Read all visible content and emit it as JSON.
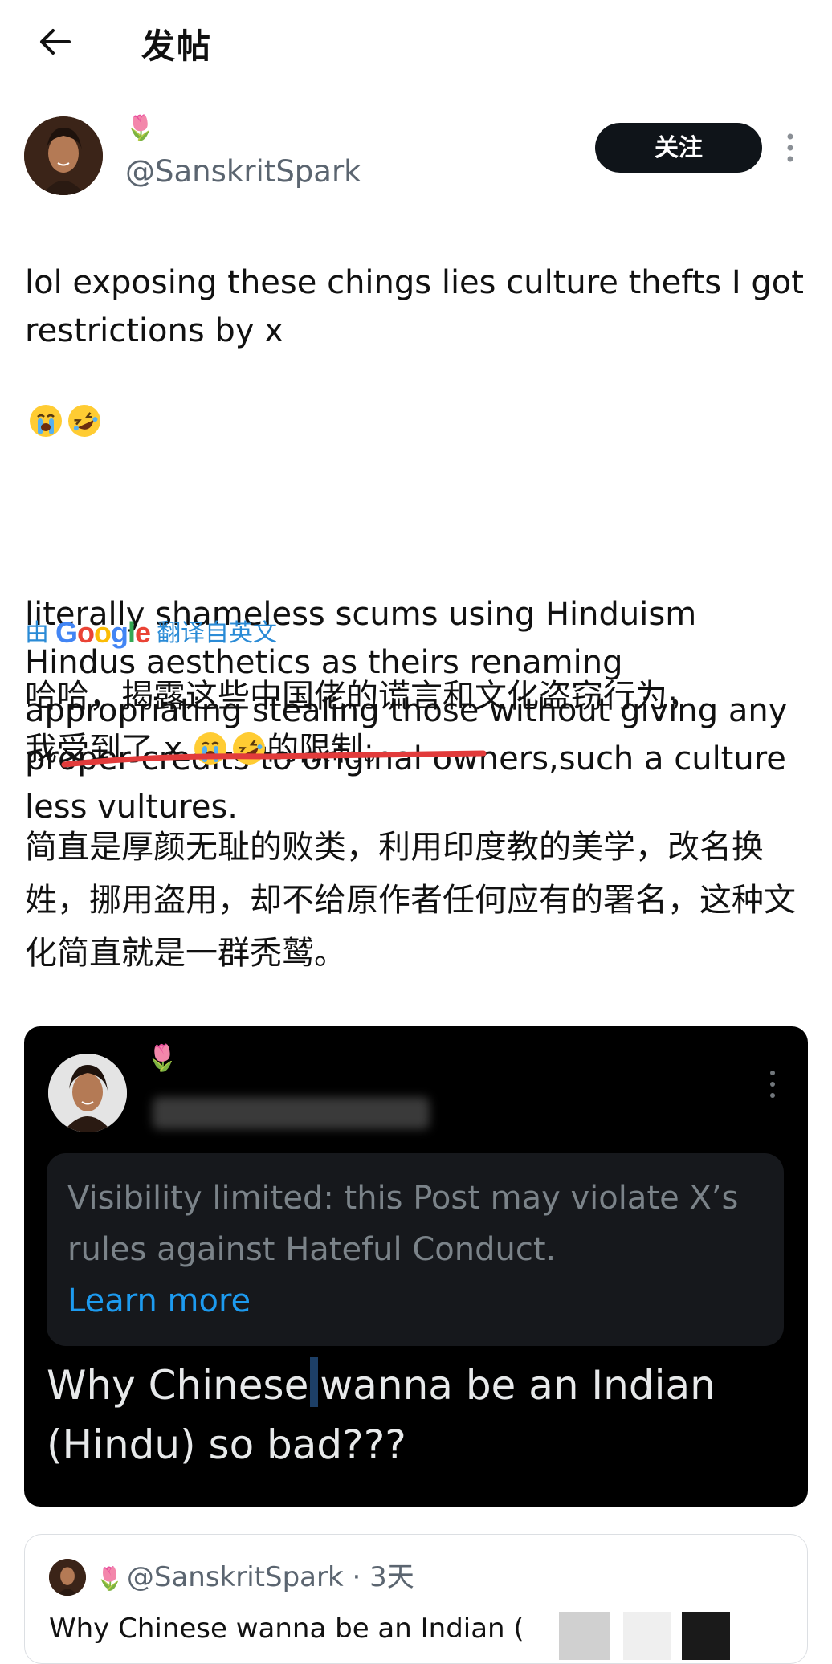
{
  "header": {
    "title": "发帖"
  },
  "author": {
    "display_name": "🌷",
    "handle": "@SanskritSpark"
  },
  "follow_button": {
    "label": "关注"
  },
  "post": {
    "english_paragraph_1": "lol exposing these chings lies culture thefts I got restrictions by x",
    "english_paragraph_2": "literally shameless scums using Hinduism Hindus aesthetics as theirs renaming appropriating stealing those without giving any proper credits to original owners,such a culture less vultures.",
    "translation": {
      "prefix": "由",
      "provider": "Google",
      "suffix": "翻译自英文"
    },
    "chinese_paragraph_1_line_1": "哈哈，揭露这些中国佬的谎言和文化盗窃行为，",
    "chinese_paragraph_1_line_2_start": "我受到了 x",
    "chinese_paragraph_1_line_2_end": "的限制。",
    "chinese_paragraph_2": "简直是厚颜无耻的败类，利用印度教的美学，改名换姓，挪用盗用，却不给原作者任何应有的署名，这种文化简直就是一群秃鹫。",
    "emoji": [
      "😭",
      "🤣"
    ]
  },
  "embedded_screenshot": {
    "display_name": "🌷",
    "warning": {
      "text": "Visibility limited: this Post may violate X’s rules against Hateful Conduct.",
      "link": "Learn more"
    },
    "post_text_start": "Why Chinese",
    "post_text_end": "wanna be an Indian (Hindu) so bad???"
  },
  "quoted_post": {
    "display_name": "🌷",
    "handle": "@SanskritSpark",
    "separator": "·",
    "time": "3天",
    "text": "Why Chinese wanna be an Indian ("
  },
  "colors": {
    "follow_bg": "#0f1419",
    "link_blue": "#1d9bf0",
    "translate_blue": "#2a8bd6",
    "underline_red": "#e23b3b",
    "dark_card_bg": "#000000"
  }
}
